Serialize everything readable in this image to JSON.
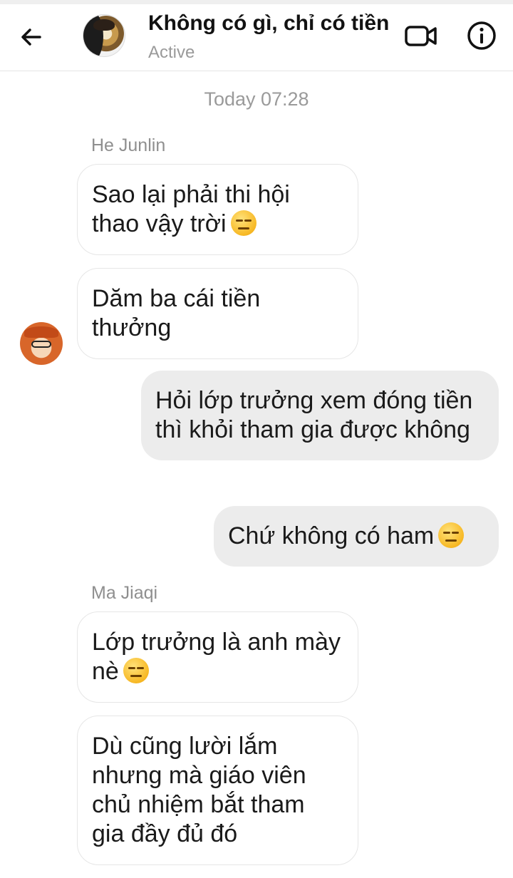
{
  "header": {
    "title": "Không có gì, chỉ có tiền",
    "status": "Active",
    "back_icon": "arrow-left-icon",
    "video_icon": "video-camera-icon",
    "info_icon": "info-icon"
  },
  "conversation": {
    "timestamp": "Today 07:28",
    "groups": [
      {
        "sender": "He Junlin",
        "messages": [
          "Sao lại phải thi hội thao vậy trời",
          "Dăm ba cái tiền thưởng"
        ]
      },
      {
        "sender": "me",
        "messages": [
          "Hỏi lớp trưởng xem đóng tiền thì khỏi tham gia được không",
          "Chứ không có ham"
        ]
      },
      {
        "sender": "Ma Jiaqi",
        "messages": [
          "Lớp trưởng là anh mày nè",
          "Dù cũng lười lắm nhưng mà giáo viên chủ nhiệm bắt tham gia đầy đủ đó"
        ]
      }
    ]
  },
  "colors": {
    "incoming_bubble": "#ffffff",
    "outgoing_bubble": "#ececec",
    "secondary_text": "#9a9a9a",
    "emoji": "#f7b824"
  }
}
